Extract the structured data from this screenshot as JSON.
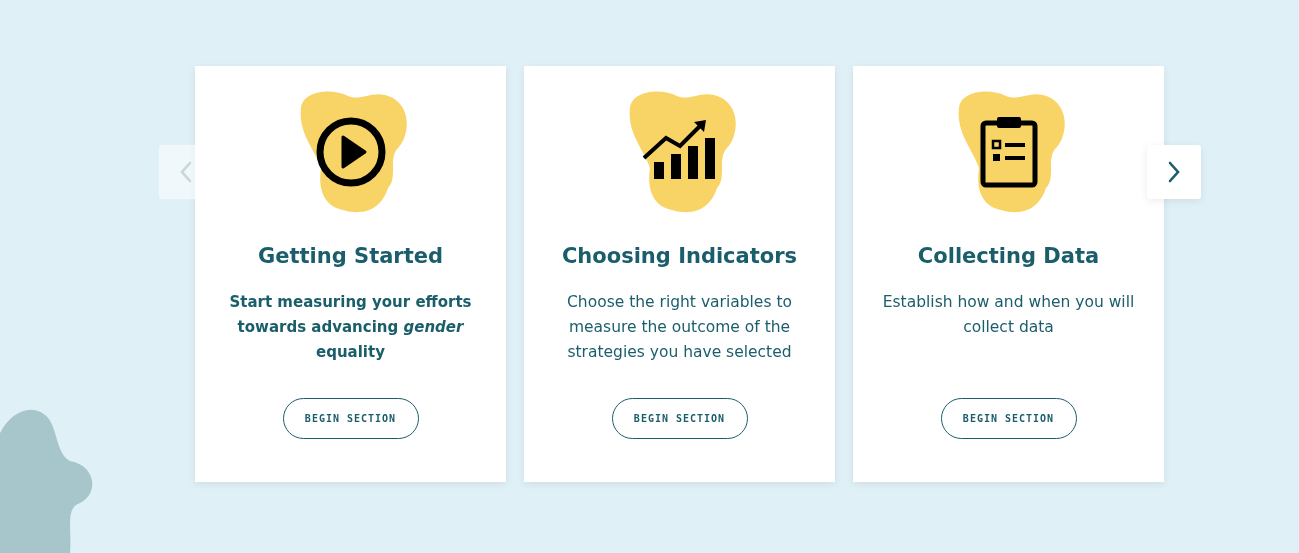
{
  "carousel": {
    "previous_button": {
      "disabled": true
    },
    "next_button": {
      "disabled": false
    }
  },
  "cards": [
    {
      "kind": "play",
      "title": "Getting Started",
      "description": "Start measuring your efforts towards advancing *gender* equality",
      "bold": true,
      "button": "BEGIN SECTION"
    },
    {
      "kind": "chart",
      "title": "Choosing Indicators",
      "description": "Choose the right variables to measure the outcome of the strategies you have selected",
      "bold": false,
      "button": "BEGIN SECTION"
    },
    {
      "kind": "clipboard",
      "title": "Collecting Data",
      "description": "Establish how and when you will collect data",
      "bold": false,
      "button": "BEGIN SECTION"
    }
  ]
}
